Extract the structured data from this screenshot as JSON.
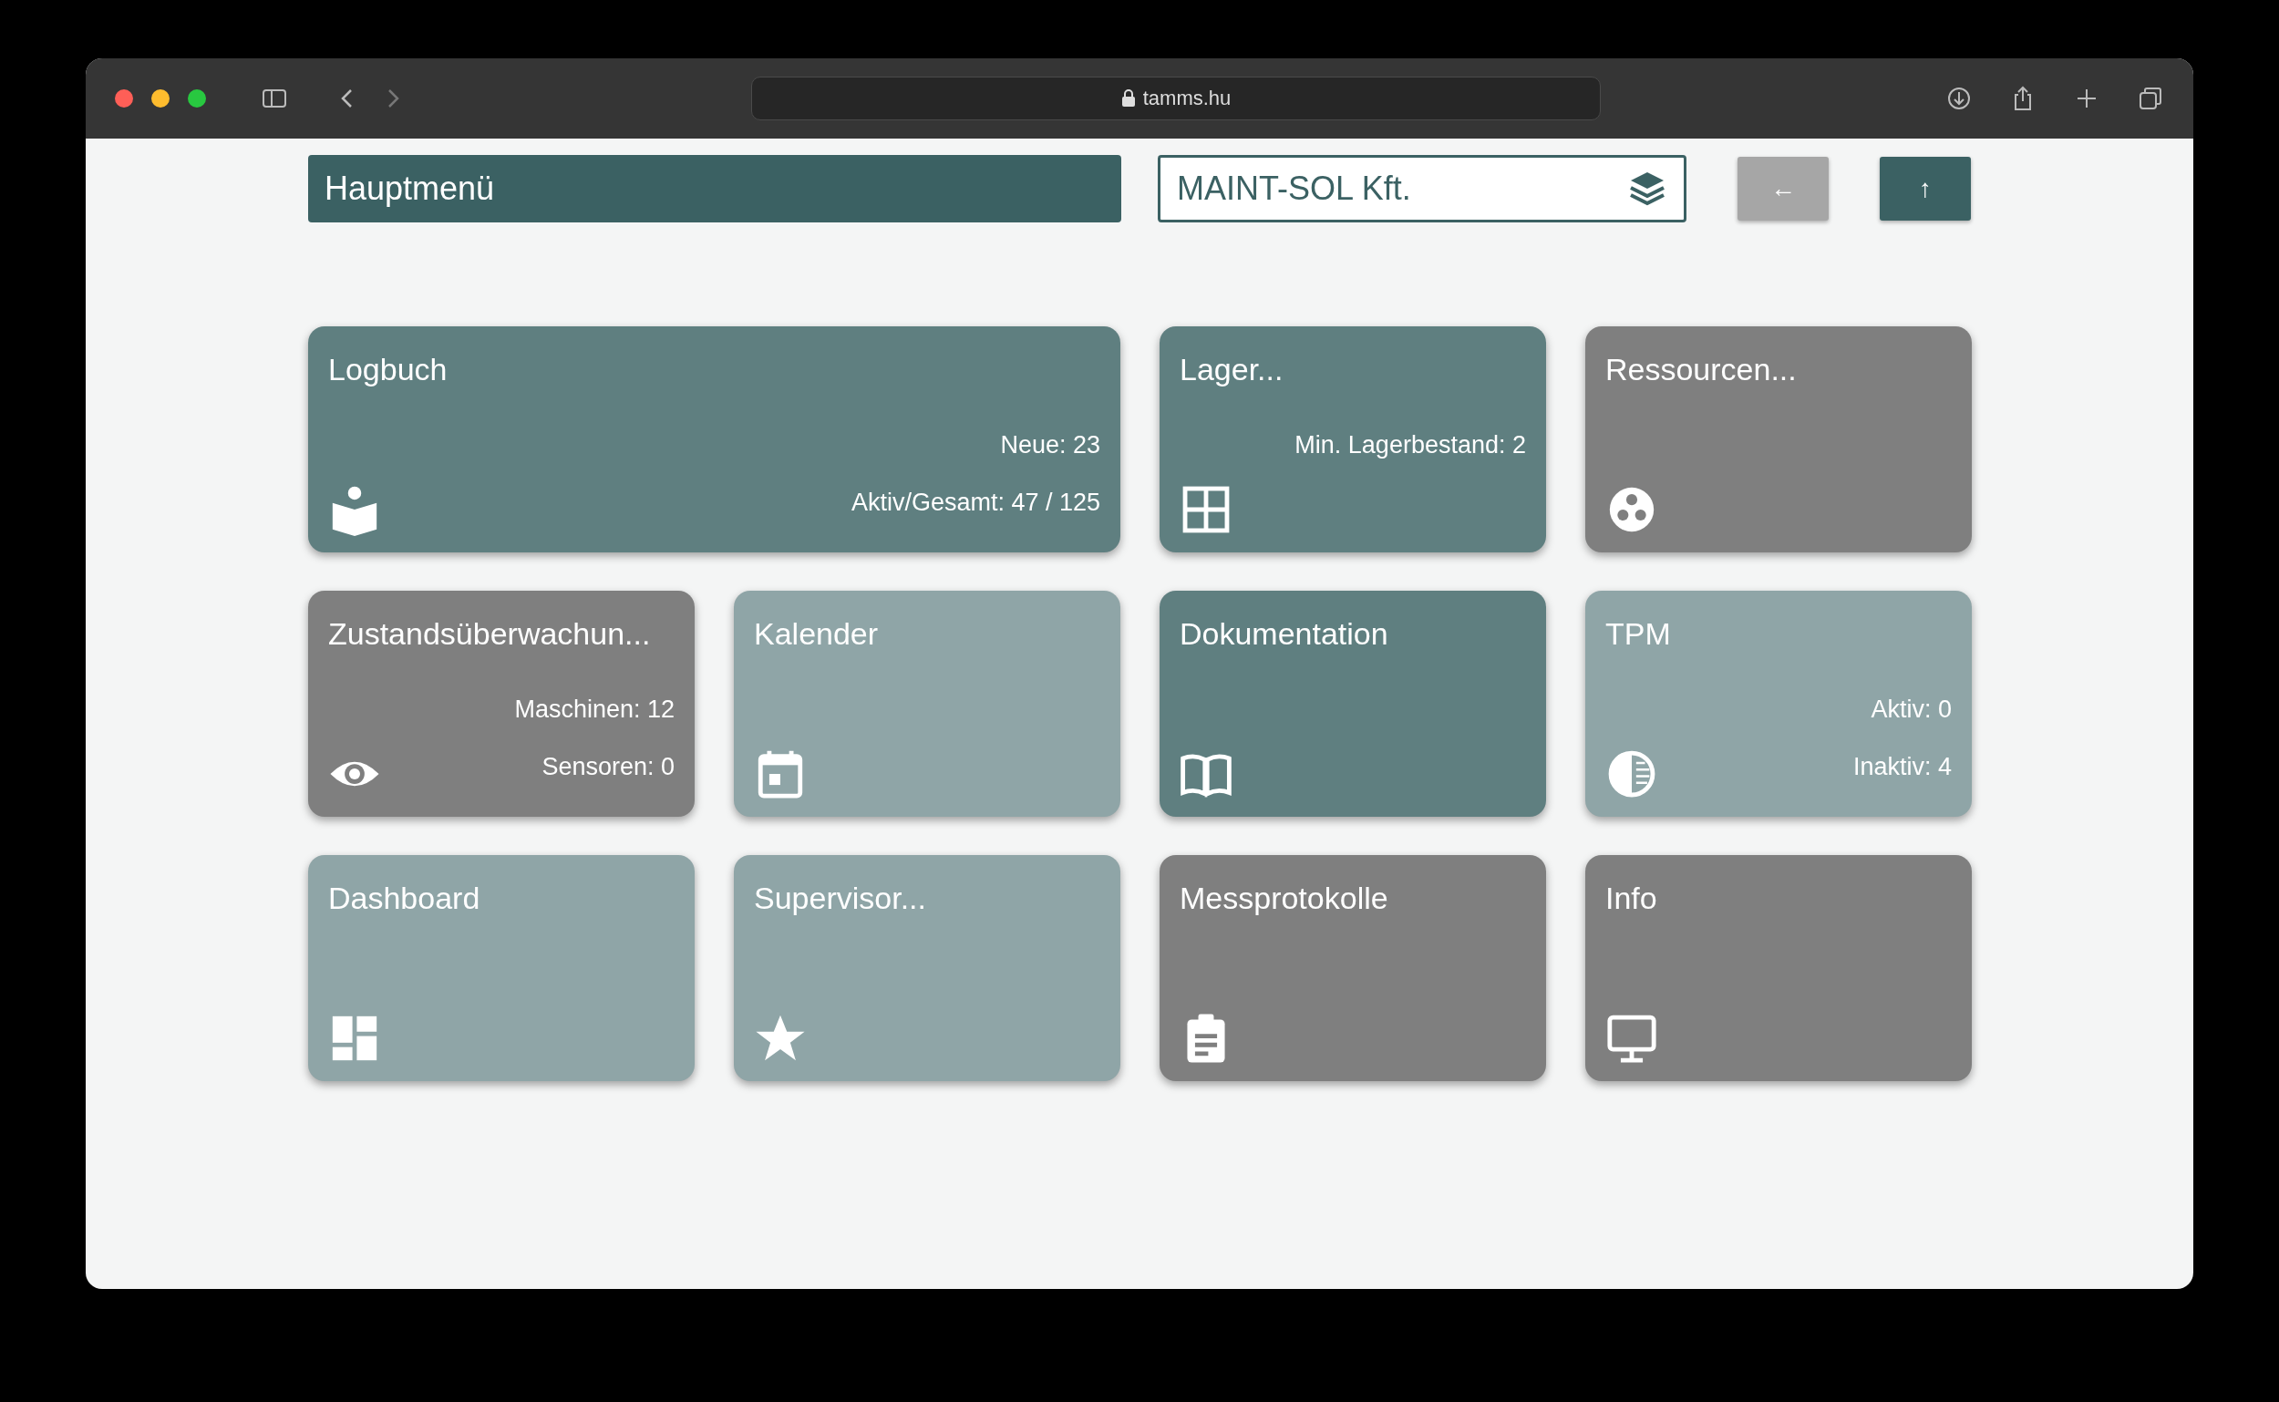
{
  "browser": {
    "url": "tamms.hu"
  },
  "header": {
    "title": "Hauptmenü",
    "company": "MAINT-SOL Kft.",
    "back_button": {
      "label": "←",
      "disabled": true
    },
    "up_button": {
      "label": "↑",
      "disabled": false
    }
  },
  "tiles": [
    {
      "title": "Logbuch",
      "wide": true,
      "color": "#5f7f80",
      "stats": [
        "Neue: 23",
        "Aktiv/Gesamt: 47 / 125"
      ]
    },
    {
      "title": "Lager...",
      "wide": false,
      "color": "#5f7f80",
      "stats": [
        "Min. Lagerbestand: 2"
      ]
    },
    {
      "title": "Ressourcen...",
      "wide": false,
      "color": "#7f7f7f"
    },
    {
      "title": "Zustandsüberwachun...",
      "wide": false,
      "color": "#7f7f7f",
      "stats": [
        "Maschinen: 12",
        "Sensoren: 0"
      ]
    },
    {
      "title": "Kalender",
      "wide": false,
      "color": "#8fa5a7"
    },
    {
      "title": "Dokumentation",
      "wide": false,
      "color": "#5f7f80"
    },
    {
      "title": "TPM",
      "wide": false,
      "color": "#8fa5a7",
      "stats": [
        "Aktiv: 0",
        "Inaktiv: 4"
      ]
    },
    {
      "title": "Dashboard",
      "wide": false,
      "color": "#8fa5a7"
    },
    {
      "title": "Supervisor...",
      "wide": false,
      "color": "#8fa5a7"
    },
    {
      "title": "Messprotokolle",
      "wide": false,
      "color": "#7f7f7f"
    },
    {
      "title": "Info",
      "wide": false,
      "color": "#7f7f7f"
    }
  ]
}
